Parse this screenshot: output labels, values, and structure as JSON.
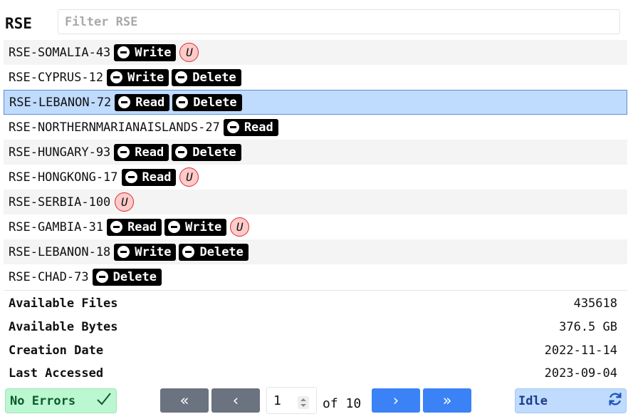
{
  "title": "RSE",
  "filter": {
    "placeholder": "Filter RSE",
    "value": ""
  },
  "rows": [
    {
      "name": "RSE-SOMALIA-43",
      "badges": [
        "Write"
      ],
      "unavailable": true,
      "u": "U"
    },
    {
      "name": "RSE-CYPRUS-12",
      "badges": [
        "Write",
        "Delete"
      ],
      "unavailable": false
    },
    {
      "name": "RSE-LEBANON-72",
      "badges": [
        "Read",
        "Delete"
      ],
      "unavailable": false,
      "selected": true
    },
    {
      "name": "RSE-NORTHERNMARIANAISLANDS-27",
      "badges": [
        "Read"
      ],
      "unavailable": false
    },
    {
      "name": "RSE-HUNGARY-93",
      "badges": [
        "Read",
        "Delete"
      ],
      "unavailable": false
    },
    {
      "name": "RSE-HONGKONG-17",
      "badges": [
        "Read"
      ],
      "unavailable": true,
      "u": "U"
    },
    {
      "name": "RSE-SERBIA-100",
      "badges": [],
      "unavailable": true,
      "u": "U"
    },
    {
      "name": "RSE-GAMBIA-31",
      "badges": [
        "Read",
        "Write"
      ],
      "unavailable": true,
      "u": "U"
    },
    {
      "name": "RSE-LEBANON-18",
      "badges": [
        "Write",
        "Delete"
      ],
      "unavailable": false
    },
    {
      "name": "RSE-CHAD-73",
      "badges": [
        "Delete"
      ],
      "unavailable": false
    }
  ],
  "info": [
    {
      "key": "Available Files",
      "value": "435618"
    },
    {
      "key": "Available Bytes",
      "value": "376.5 GB"
    },
    {
      "key": "Creation Date",
      "value": "2022-11-14"
    },
    {
      "key": "Last Accessed",
      "value": "2023-09-04"
    }
  ],
  "footer": {
    "status_left": "No Errors",
    "status_right": "Idle",
    "first_label": "«",
    "prev_label": "‹",
    "next_label": "›",
    "last_label": "»",
    "page_value": "1",
    "of_text": "of 10"
  },
  "colors": {
    "selected_row": "#bfdbfe",
    "ok_status": "#bbf7d0",
    "idle_status": "#bfdbfe",
    "nav_disabled": "#6b7280",
    "nav_enabled": "#3b82f6",
    "unavailable_badge": "#fecaca"
  },
  "icons": {
    "availability_badge": "minus-circle-icon",
    "ok": "checkmark-icon",
    "idle": "refresh-icon"
  }
}
